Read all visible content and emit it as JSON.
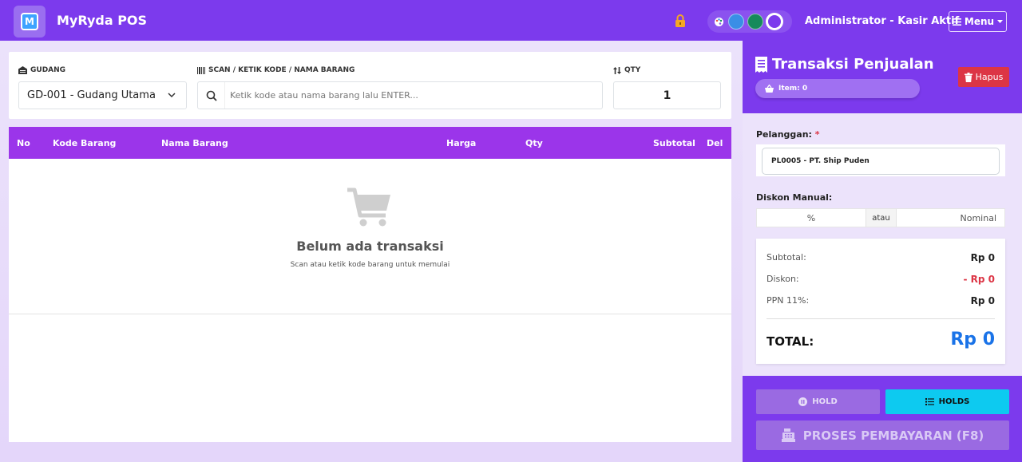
{
  "header": {
    "app_title": "MyRyda POS",
    "logo_letter": "M",
    "user_label": "Administrator - Kasir Aktif",
    "menu_label": "Menu",
    "theme_swatches": [
      "#3a8ee6",
      "#168a5b",
      "#7c3aed"
    ],
    "brand_color": "#7c3aed"
  },
  "inputs": {
    "gudang_label": "GUDANG",
    "gudang_value": "GD-001 - Gudang Utama",
    "scan_label": "SCAN / KETIK KODE / NAMA BARANG",
    "scan_placeholder": "Ketik kode atau nama barang lalu ENTER...",
    "qty_label": "QTY",
    "qty_value": "1"
  },
  "table": {
    "columns": [
      "No",
      "Kode Barang",
      "Nama Barang",
      "Harga",
      "Qty",
      "Subtotal",
      "Del"
    ],
    "rows": [],
    "empty_title": "Belum ada transaksi",
    "empty_subtitle": "Scan atau ketik kode barang untuk memulai"
  },
  "sidebar": {
    "title": "Transaksi Penjualan",
    "item_badge": "Item: 0",
    "hapus_label": "Hapus",
    "customer_label": "Pelanggan:",
    "required_mark": "*",
    "customer_value": "PL0005 - PT. Ship Puden",
    "discount_label": "Diskon Manual:",
    "discount_percent_placeholder": "%",
    "discount_or": "atau",
    "discount_nominal_placeholder": "Nominal",
    "summary": {
      "subtotal_label": "Subtotal:",
      "subtotal_value": "Rp 0",
      "discount_label": "Diskon:",
      "discount_value": "- Rp 0",
      "tax_label": "PPN 11%:",
      "tax_value": "Rp 0",
      "total_label": "TOTAL:",
      "total_value": "Rp 0"
    },
    "hold_label": "HOLD",
    "holds_label": "HOLDS",
    "pay_label": "PROSES PEMBAYARAN (F8)"
  }
}
